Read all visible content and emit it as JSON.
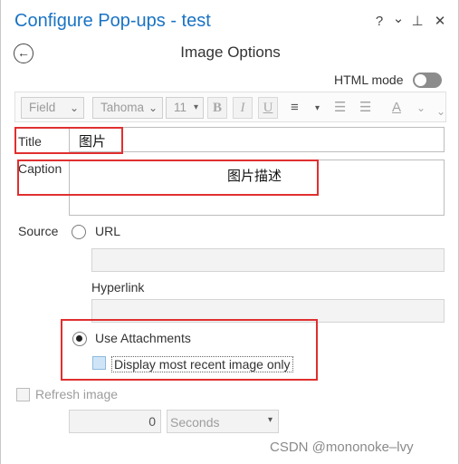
{
  "pane": {
    "title": "Configure Pop-ups - test",
    "help_glyph": "?",
    "menu_glyph": "⌄",
    "pin_glyph": "⊥",
    "close_glyph": "✕"
  },
  "panel": {
    "heading": "Image Options",
    "back_glyph": "←"
  },
  "html_mode": {
    "label": "HTML mode",
    "enabled": false
  },
  "toolbar": {
    "field_select": "Field",
    "font_select": "Tahoma",
    "size_select": "11",
    "bold": "B",
    "italic": "I",
    "underline": "U",
    "align_glyph": "≡",
    "bullets_glyph": "☰",
    "numbering_glyph": "☰",
    "font_color_glyph": "A",
    "dropdown_glyph": "▾",
    "overflow_glyph": "⌄"
  },
  "title_field": {
    "label": "Title",
    "value": "图片"
  },
  "caption_field": {
    "label": "Caption",
    "value": "图片描述"
  },
  "source": {
    "label": "Source",
    "url_label": "URL",
    "url_value": "",
    "hyperlink_label": "Hyperlink",
    "hyperlink_value": "",
    "use_attachments_label": "Use Attachments",
    "use_attachments_selected": true,
    "url_selected": false,
    "display_recent_label": "Display most recent image only",
    "display_recent_checked": false
  },
  "refresh": {
    "label": "Refresh image",
    "checked": false,
    "interval_value": "0",
    "unit": "Seconds"
  },
  "watermark": "CSDN @mononoke–lvy",
  "colors": {
    "title_blue": "#1a73c4",
    "highlight_red": "#e02f2f",
    "checkbox_blue": "#cfe5f7"
  }
}
